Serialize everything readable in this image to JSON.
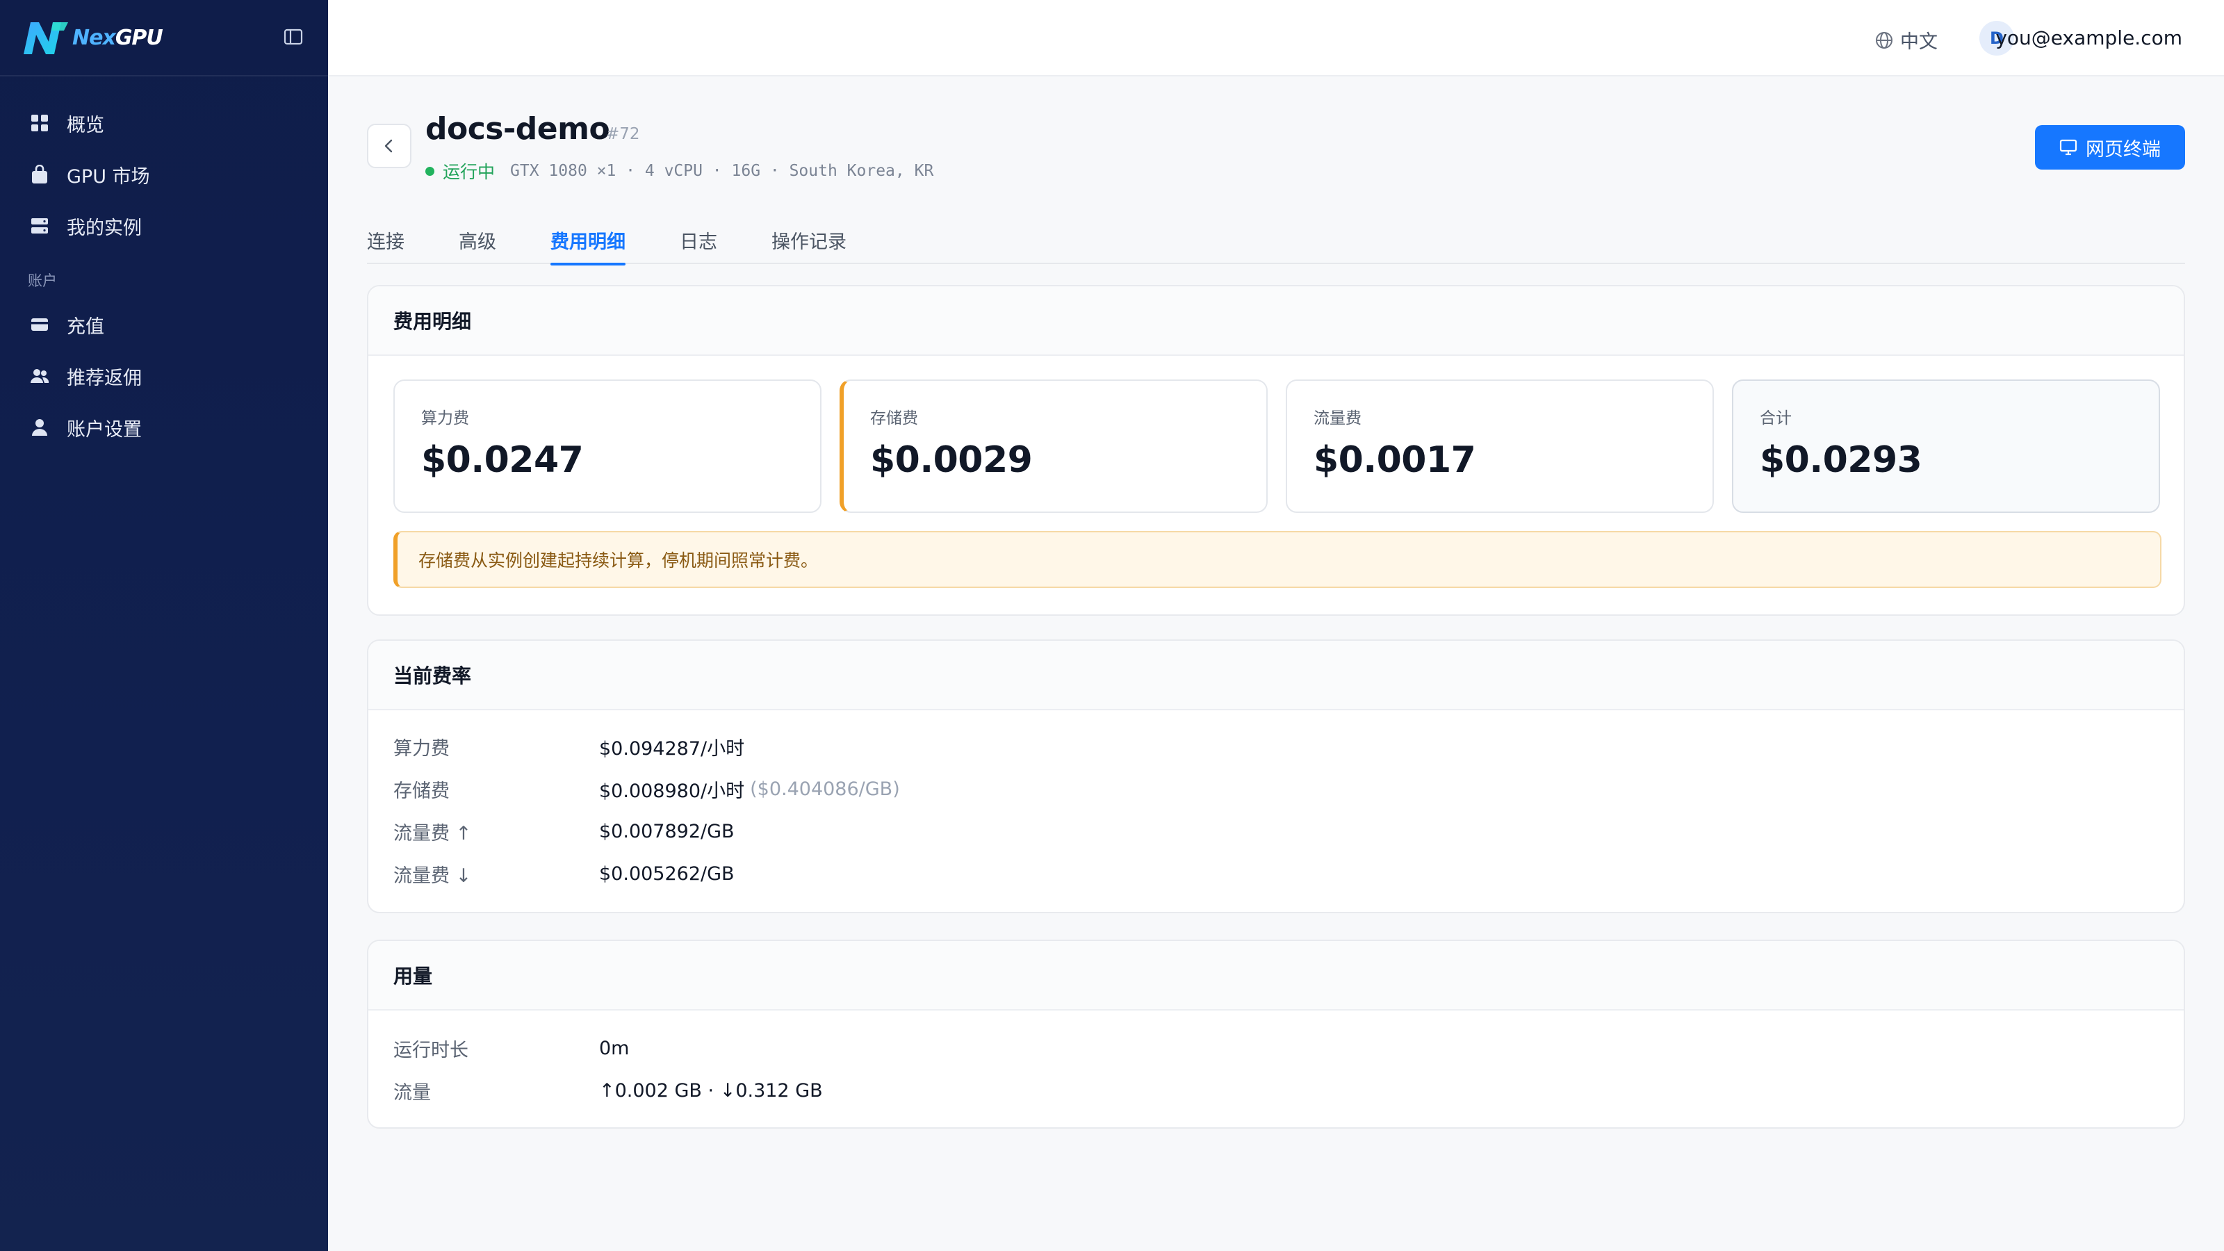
{
  "brand": {
    "name_a": "Nex",
    "name_b": "GPU"
  },
  "sidebar": {
    "items": [
      {
        "label": "概览",
        "icon": "grid-icon"
      },
      {
        "label": "GPU 市场",
        "icon": "bag-icon"
      },
      {
        "label": "我的实例",
        "icon": "server-icon"
      }
    ],
    "section_label": "账户",
    "account_items": [
      {
        "label": "充值",
        "icon": "card-icon"
      },
      {
        "label": "推荐返佣",
        "icon": "users-icon"
      },
      {
        "label": "账户设置",
        "icon": "user-icon"
      }
    ]
  },
  "topbar": {
    "language": "中文",
    "avatar_letter": "D",
    "email": "you@example.com"
  },
  "instance": {
    "name": "docs-demo",
    "id": "#72",
    "status": "运行中",
    "specs": "GTX 1080 ×1 · 4 vCPU · 16G · South Korea, KR",
    "terminal_button": "网页终端"
  },
  "tabs": [
    {
      "label": "连接",
      "active": false
    },
    {
      "label": "高级",
      "active": false
    },
    {
      "label": "费用明细",
      "active": true
    },
    {
      "label": "日志",
      "active": false
    },
    {
      "label": "操作记录",
      "active": false
    }
  ],
  "cost_details": {
    "title": "费用明细",
    "items": [
      {
        "label": "算力费",
        "value": "$0.0247"
      },
      {
        "label": "存储费",
        "value": "$0.0029"
      },
      {
        "label": "流量费",
        "value": "$0.0017"
      },
      {
        "label": "合计",
        "value": "$0.0293"
      }
    ],
    "notice": "存储费从实例创建起持续计算，停机期间照常计费。"
  },
  "current_rates": {
    "title": "当前费率",
    "rows": [
      {
        "key": "算力费",
        "value": "$0.094287/小时",
        "sub": ""
      },
      {
        "key": "存储费",
        "value": "$0.008980/小时",
        "sub": "($0.404086/GB)"
      },
      {
        "key": "流量费 ↑",
        "value": "$0.007892/GB",
        "sub": ""
      },
      {
        "key": "流量费 ↓",
        "value": "$0.005262/GB",
        "sub": ""
      }
    ]
  },
  "usage": {
    "title": "用量",
    "rows": [
      {
        "key": "运行时长",
        "value": "0m"
      },
      {
        "key": "流量",
        "value": "↑0.002 GB · ↓0.312 GB"
      }
    ]
  },
  "colors": {
    "sidebar_bg": "#0f1d4a",
    "accent": "#1677ff",
    "running": "#22b35e",
    "warning": "#f0a028"
  }
}
